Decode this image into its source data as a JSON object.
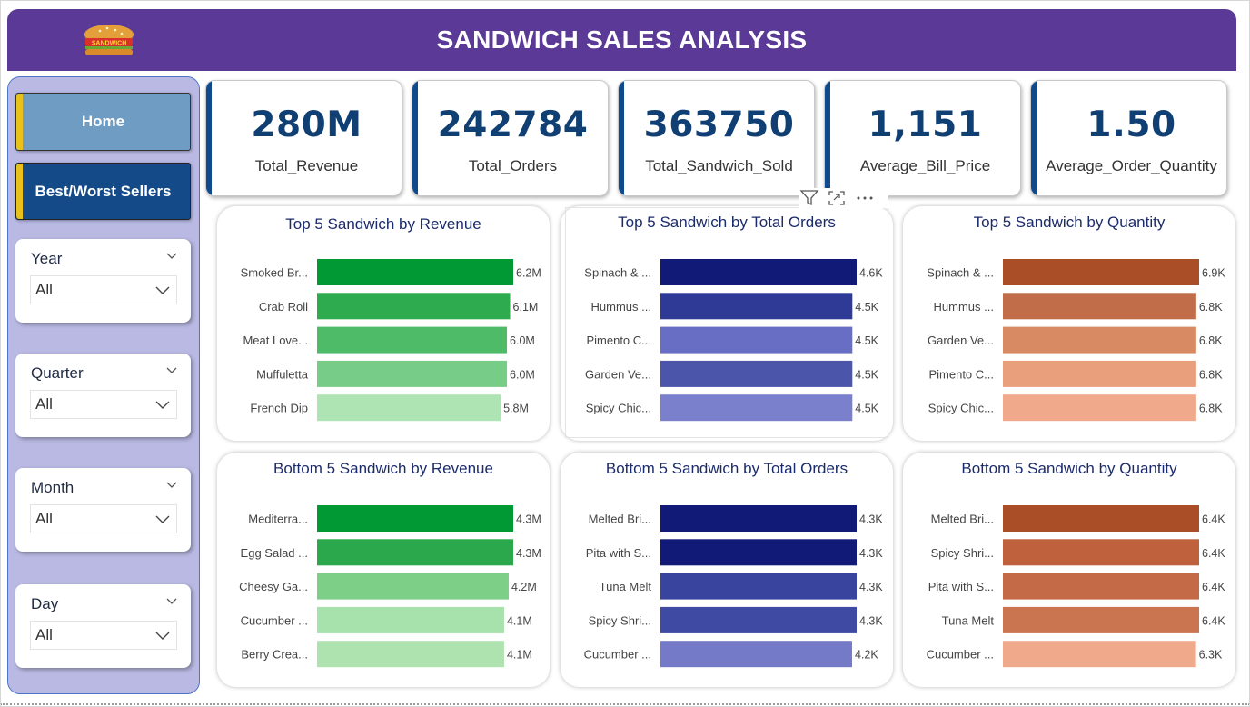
{
  "header": {
    "title": "SANDWICH SALES ANALYSIS",
    "logo_text": "SANDWICH"
  },
  "nav": {
    "home_label": "Home",
    "best_worst_label": "Best/Worst Sellers"
  },
  "slicers": [
    {
      "label": "Year",
      "value": "All"
    },
    {
      "label": "Quarter",
      "value": "All"
    },
    {
      "label": "Month",
      "value": "All"
    },
    {
      "label": "Day",
      "value": "All"
    }
  ],
  "kpis": [
    {
      "value": "280M",
      "label": "Total_Revenue"
    },
    {
      "value": "242784",
      "label": "Total_Orders"
    },
    {
      "value": "363750",
      "label": "Total_Sandwich_Sold"
    },
    {
      "value": "1,151",
      "label": "Average_Bill_Price"
    },
    {
      "value": "1.50",
      "label": "Average_Order_Quantity"
    }
  ],
  "colors": {
    "header": "#5a3a96",
    "kpi_accent": "#0f4a8c",
    "nav_accent": "#e8c21b"
  },
  "chart_data": [
    {
      "type": "bar",
      "title": "Top 5 Sandwich by Revenue",
      "categories": [
        "Smoked Br...",
        "Crab Roll",
        "Meat Love...",
        "Muffuletta",
        "French Dip"
      ],
      "values": [
        6.2,
        6.1,
        6.0,
        6.0,
        5.8
      ],
      "unit": "M",
      "data_labels": [
        "6.2M",
        "6.1M",
        "6.0M",
        "6.0M",
        "5.8M"
      ],
      "colors": [
        "#009933",
        "#2eab4e",
        "#4dbb68",
        "#77cc87",
        "#aee3b3"
      ]
    },
    {
      "type": "bar",
      "title": "Top 5 Sandwich by Total Orders",
      "categories": [
        "Spinach & ...",
        "Hummus ...",
        "Pimento C...",
        "Garden Ve...",
        "Spicy Chic..."
      ],
      "values": [
        4.6,
        4.5,
        4.5,
        4.5,
        4.5
      ],
      "unit": "K",
      "data_labels": [
        "4.6K",
        "4.5K",
        "4.5K",
        "4.5K",
        "4.5K"
      ],
      "colors": [
        "#121a78",
        "#2e3a96",
        "#676ec4",
        "#4b55a9",
        "#7a80cc"
      ]
    },
    {
      "type": "bar",
      "title": "Top 5 Sandwich by Quantity",
      "categories": [
        "Spinach & ...",
        "Hummus ...",
        "Garden Ve...",
        "Pimento C...",
        "Spicy Chic..."
      ],
      "values": [
        6.9,
        6.8,
        6.8,
        6.8,
        6.8
      ],
      "unit": "K",
      "data_labels": [
        "6.9K",
        "6.8K",
        "6.8K",
        "6.8K",
        "6.8K"
      ],
      "colors": [
        "#aa4e27",
        "#c26d4a",
        "#d88a63",
        "#e99f7c",
        "#f0a98a"
      ]
    },
    {
      "type": "bar",
      "title": "Bottom 5 Sandwich by Revenue",
      "categories": [
        "Mediterra...",
        "Egg Salad ...",
        "Cheesy Ga...",
        "Cucumber ...",
        "Berry Crea..."
      ],
      "values": [
        4.3,
        4.3,
        4.2,
        4.1,
        4.1
      ],
      "unit": "M",
      "data_labels": [
        "4.3M",
        "4.3M",
        "4.2M",
        "4.1M",
        "4.1M"
      ],
      "colors": [
        "#009933",
        "#2aa84b",
        "#7dcf87",
        "#a7e1ac",
        "#aee3b0"
      ]
    },
    {
      "type": "bar",
      "title": "Bottom 5 Sandwich by Total Orders",
      "categories": [
        "Melted Bri...",
        "Pita with S...",
        "Tuna Melt",
        "Spicy Shri...",
        "Cucumber ..."
      ],
      "values": [
        4.3,
        4.3,
        4.3,
        4.3,
        4.2
      ],
      "unit": "K",
      "data_labels": [
        "4.3K",
        "4.3K",
        "4.3K",
        "4.3K",
        "4.2K"
      ],
      "colors": [
        "#121a78",
        "#121a78",
        "#39449e",
        "#3f4aa3",
        "#7479c8"
      ]
    },
    {
      "type": "bar",
      "title": "Bottom 5 Sandwich by Quantity",
      "categories": [
        "Melted Bri...",
        "Spicy Shri...",
        "Pita with S...",
        "Tuna Melt",
        "Cucumber ..."
      ],
      "values": [
        6.4,
        6.4,
        6.4,
        6.4,
        6.3
      ],
      "unit": "K",
      "data_labels": [
        "6.4K",
        "6.4K",
        "6.4K",
        "6.4K",
        "6.3K"
      ],
      "colors": [
        "#aa4e27",
        "#bf613c",
        "#c46a47",
        "#cb7550",
        "#f0a98a"
      ]
    }
  ]
}
